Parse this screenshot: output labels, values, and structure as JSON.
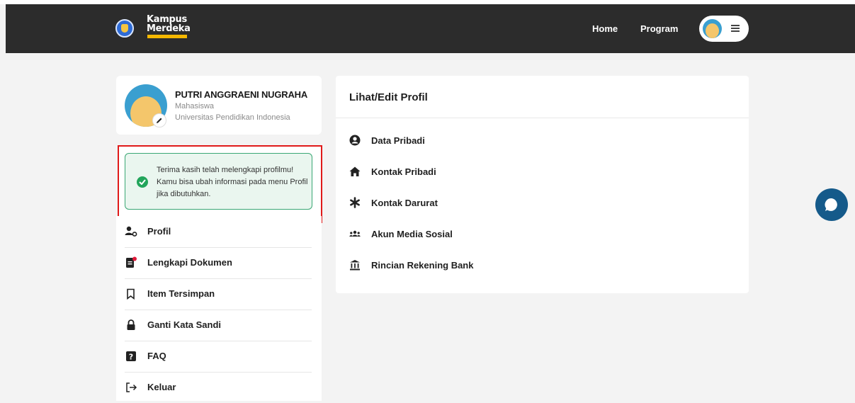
{
  "navbar": {
    "logo_line1": "Kampus",
    "logo_line2": "Merdeka",
    "links": [
      "Home",
      "Program"
    ]
  },
  "profile": {
    "name": "PUTRI ANGGRAENI NUGRAHA",
    "role": "Mahasiswa",
    "university": "Universitas Pendidikan Indonesia"
  },
  "notice": {
    "text": "Terima kasih telah melengkapi profilmu! Kamu bisa ubah informasi pada menu Profil jika dibutuhkan."
  },
  "side_menu": {
    "items": [
      {
        "label": "Profil",
        "icon": "user-gear-icon"
      },
      {
        "label": "Lengkapi Dokumen",
        "icon": "document-alert-icon"
      },
      {
        "label": "Item Tersimpan",
        "icon": "bookmark-icon"
      },
      {
        "label": "Ganti Kata Sandi",
        "icon": "lock-icon"
      },
      {
        "label": "FAQ",
        "icon": "question-icon"
      },
      {
        "label": "Keluar",
        "icon": "logout-icon"
      }
    ]
  },
  "main": {
    "title": "Lihat/Edit Profil",
    "options": [
      {
        "label": "Data Pribadi",
        "icon": "user-circle-icon"
      },
      {
        "label": "Kontak Pribadi",
        "icon": "home-icon"
      },
      {
        "label": "Kontak Darurat",
        "icon": "asterisk-icon"
      },
      {
        "label": "Akun Media Sosial",
        "icon": "users-icon"
      },
      {
        "label": "Rincian Rekening Bank",
        "icon": "bank-icon"
      }
    ]
  },
  "colors": {
    "navbar_bg": "#2c2c2c",
    "notice_border": "#3aa774",
    "notice_bg": "#eaf6ef",
    "highlight_border": "#e01a1a",
    "chat_button": "#155a8a"
  }
}
